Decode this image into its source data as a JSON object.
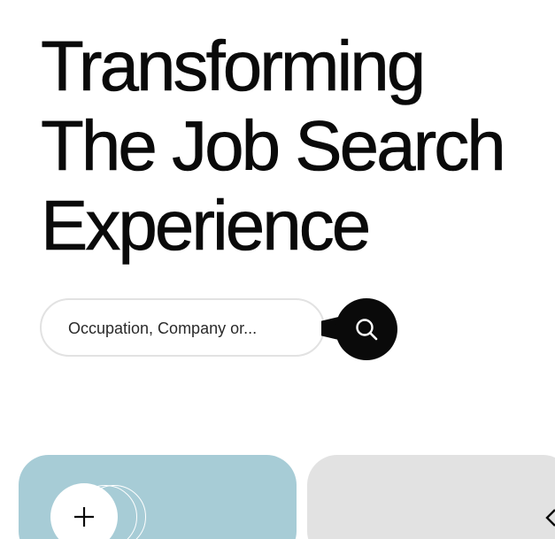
{
  "hero": {
    "line1": "Transforming",
    "line2": "The Job Search",
    "line3": "Experience"
  },
  "search": {
    "placeholder": "Occupation, Company or...",
    "button_icon": "search-icon"
  },
  "cards": {
    "first": {
      "background": "#a7ccd6",
      "button_icon": "plus-icon"
    },
    "second": {
      "background": "#e2e2e2",
      "icon": "arrow-icon"
    }
  },
  "colors": {
    "text": "#0a0a0a",
    "search_button": "#0a0a0a",
    "pill_border": "#e2e2e2"
  }
}
